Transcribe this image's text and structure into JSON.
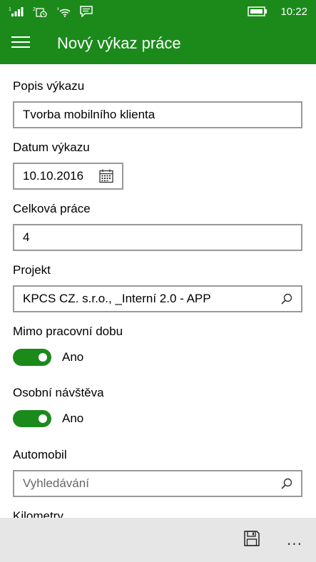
{
  "status_bar": {
    "time": "10:22",
    "signal_icon": "signal-bars-icon",
    "sim2_icon": "sim2-signal-icon",
    "wifi_icon": "wifi-icon",
    "message_icon": "message-icon",
    "battery_icon": "battery-icon"
  },
  "app_bar": {
    "title": "Nový výkaz práce",
    "menu_icon": "hamburger-menu-icon"
  },
  "form": {
    "description": {
      "label": "Popis výkazu",
      "value": "Tvorba mobilního klienta"
    },
    "date": {
      "label": "Datum výkazu",
      "value": "10.10.2016",
      "icon": "calendar-icon"
    },
    "total_work": {
      "label": "Celková práce",
      "value": "4"
    },
    "project": {
      "label": "Projekt",
      "value": "KPCS CZ. s.r.o., _Interní 2.0 - APP",
      "icon": "search-icon"
    },
    "outside_hours": {
      "label": "Mimo pracovní dobu",
      "state_label": "Ano",
      "on": true
    },
    "personal_visit": {
      "label": "Osobní návštěva",
      "state_label": "Ano",
      "on": true
    },
    "car": {
      "label": "Automobil",
      "placeholder": "Vyhledávání",
      "icon": "search-icon"
    },
    "kilometers": {
      "label": "Kilometry"
    }
  },
  "command_bar": {
    "save_icon": "save-icon",
    "more_label": "..."
  },
  "colors": {
    "accent": "#1b8a1b",
    "command_bar_bg": "#e6e6e6",
    "border": "#999999"
  }
}
